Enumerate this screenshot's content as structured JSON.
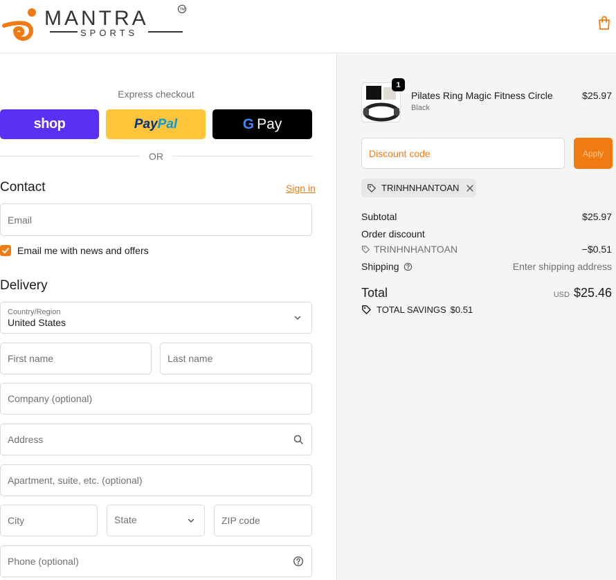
{
  "header": {
    "brand_name": "MANTRA",
    "brand_tagline": "SPORTS",
    "brand_mark": "TM",
    "cart_icon": "shopping-bag-icon",
    "accent_color": "#f07b12"
  },
  "express": {
    "label": "Express checkout",
    "shop_label": "shop",
    "paypal_label_1": "Pay",
    "paypal_label_2": "Pal",
    "gpay_label": "Pay",
    "or_label": "OR"
  },
  "contact": {
    "title": "Contact",
    "sign_in": "Sign in",
    "email_placeholder": "Email",
    "newsletter_label": "Email me with news and offers",
    "newsletter_checked": true
  },
  "delivery": {
    "title": "Delivery",
    "country_label": "Country/Region",
    "country_value": "United States",
    "first_name": "First name",
    "last_name": "Last name",
    "company": "Company (optional)",
    "address": "Address",
    "apartment": "Apartment, suite, etc. (optional)",
    "city": "City",
    "state": "State",
    "zip": "ZIP code",
    "phone": "Phone (optional)"
  },
  "summary": {
    "product": {
      "name": "Pilates Ring Magic Fitness Circle",
      "variant": "Black",
      "price": "$25.97",
      "quantity": "1"
    },
    "discount_placeholder": "Discount code",
    "apply_label": "Apply",
    "applied_code": "TRINHNHANTOAN",
    "subtotal_label": "Subtotal",
    "subtotal_value": "$25.97",
    "order_discount_label": "Order discount",
    "discount_code": "TRINHNHANTOAN",
    "discount_value": "−$0.51",
    "shipping_label": "Shipping",
    "shipping_value": "Enter shipping address",
    "total_label": "Total",
    "total_currency": "USD",
    "total_value": "$25.46",
    "savings_label": "TOTAL SAVINGS",
    "savings_value": "$0.51"
  }
}
